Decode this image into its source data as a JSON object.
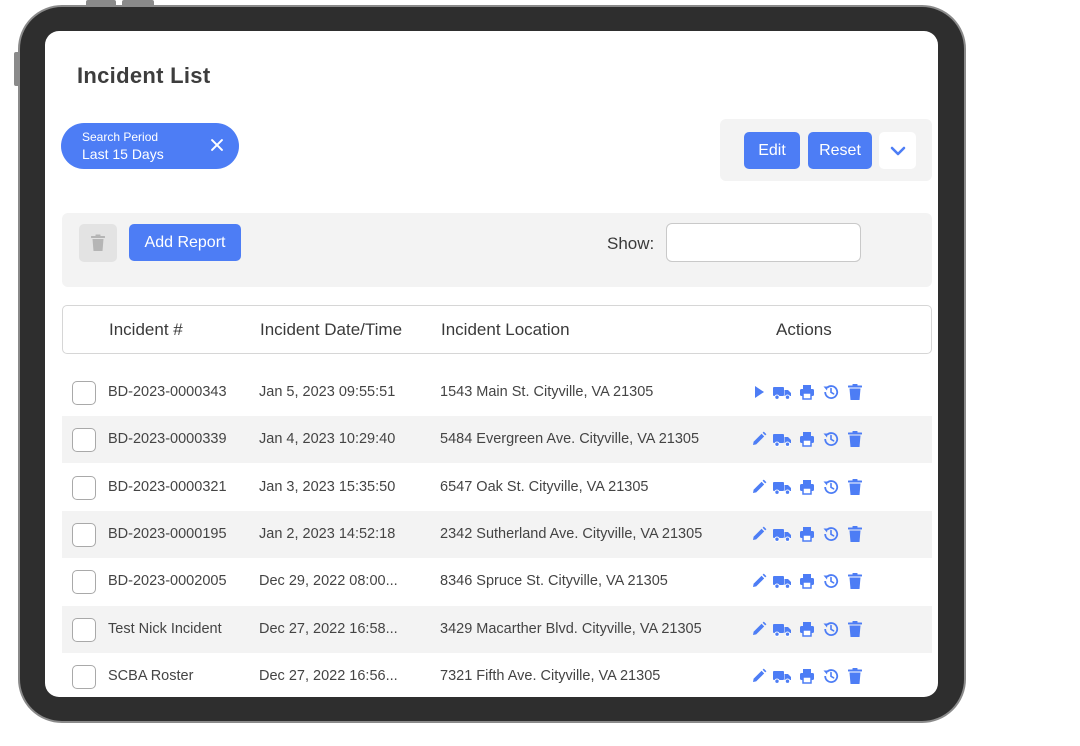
{
  "page": {
    "title": "Incident List"
  },
  "filter_chip": {
    "caption": "Search Period",
    "value": "Last 15 Days"
  },
  "toolbar": {
    "edit_label": "Edit",
    "reset_label": "Reset"
  },
  "action_bar": {
    "add_label": "Add Report",
    "show_label": "Show:",
    "show_value": ""
  },
  "table": {
    "columns": [
      "Incident #",
      "Incident Date/Time",
      "Incident Location",
      "Actions"
    ],
    "rows": [
      {
        "num": "BD-2023-0000343",
        "date": "Jan 5, 2023 09:55:51",
        "location": "1543 Main St. Cityville, VA 21305",
        "first_action": "play"
      },
      {
        "num": "BD-2023-0000339",
        "date": "Jan 4, 2023 10:29:40",
        "location": "5484 Evergreen Ave. Cityville, VA 21305",
        "first_action": "edit"
      },
      {
        "num": "BD-2023-0000321",
        "date": "Jan 3, 2023 15:35:50",
        "location": "6547 Oak St. Cityville, VA 21305",
        "first_action": "edit"
      },
      {
        "num": "BD-2023-0000195",
        "date": "Jan 2, 2023 14:52:18",
        "location": "2342 Sutherland Ave. Cityville, VA 21305",
        "first_action": "edit"
      },
      {
        "num": "BD-2023-0002005",
        "date": "Dec 29, 2022 08:00...",
        "location": "8346 Spruce St. Cityville, VA 21305",
        "first_action": "edit"
      },
      {
        "num": "Test Nick Incident",
        "date": "Dec 27, 2022 16:58...",
        "location": "3429 Macarther Blvd. Cityville, VA 21305",
        "first_action": "edit"
      },
      {
        "num": "SCBA Roster",
        "date": "Dec 27, 2022 16:56...",
        "location": "7321 Fifth Ave. Cityville, VA 21305",
        "first_action": "edit"
      }
    ]
  },
  "colors": {
    "accent": "#4d7df5",
    "device_frame": "#2e2e2e",
    "panel_bg": "#f3f3f3"
  },
  "icons": [
    "close-icon",
    "chevron-down-icon",
    "trash-icon",
    "play-icon",
    "pencil-icon",
    "truck-icon",
    "printer-icon",
    "history-icon"
  ]
}
